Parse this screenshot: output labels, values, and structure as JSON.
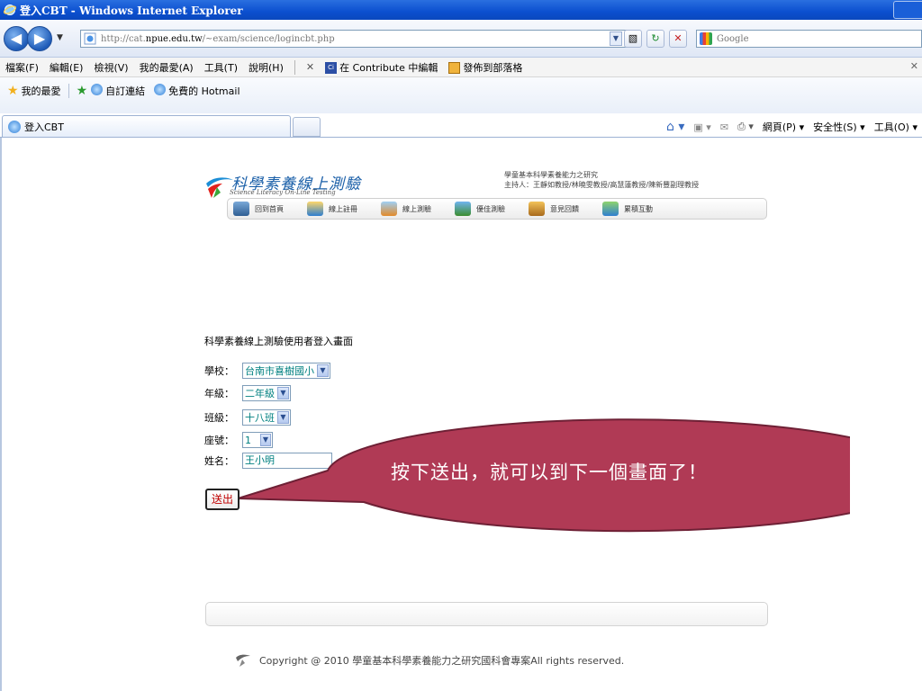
{
  "window": {
    "title": "登入CBT - Windows Internet Explorer"
  },
  "address": {
    "url_prefix": "http://cat.",
    "url_domain": "npue.edu.tw",
    "url_path": "/~exam/science/logincbt.php",
    "search_placeholder": "Google"
  },
  "menu": {
    "items": [
      "檔案(F)",
      "編輯(E)",
      "檢視(V)",
      "我的最愛(A)",
      "工具(T)",
      "說明(H)"
    ],
    "contribute_edit": "在 Contribute 中編輯",
    "publish_blog": "發佈到部落格"
  },
  "favorites": {
    "label": "我的最愛",
    "link1": "自訂連結",
    "link2": "免費的 Hotmail"
  },
  "tab": {
    "title": "登入CBT",
    "page_menu": "網頁(P)",
    "safety_menu": "安全性(S)",
    "tools_menu": "工具(O)"
  },
  "site": {
    "logo_title": "科學素養線上測驗",
    "logo_subtitle": "Science Literacy On-Line Testing",
    "project_line1": "學童基本科學素養能力之研究",
    "project_line2": "主持人：王靜如教授/林曉雯教授/高慧蓮教授/陳新豐副理教授",
    "nav": [
      "回到首頁",
      "線上註冊",
      "線上測驗",
      "優佳測驗",
      "意見回饋",
      "累積互動"
    ]
  },
  "login": {
    "title": "科學素養線上測驗使用者登入畫面",
    "school_label": "學校：",
    "school_value": "台南市喜樹國小",
    "grade_label": "年級：",
    "grade_value": "二年級",
    "class_label": "班級：",
    "class_value": "十八班",
    "seat_label": "座號：",
    "seat_value": "1",
    "name_label": "姓名：",
    "name_value": "王小明",
    "submit_label": "送出"
  },
  "callout": {
    "text": "按下送出，就可以到下一個畫面了！",
    "color": "#b03a55"
  },
  "footer": {
    "copyright": "Copyright @ 2010 學童基本科學素養能力之研究國科會專案All rights reserved."
  }
}
